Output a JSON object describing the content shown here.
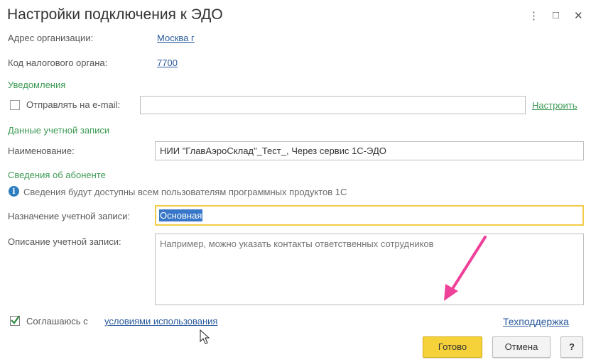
{
  "window": {
    "title": "Настройки подключения к ЭДО",
    "more_icon": "⋮",
    "maximize_icon": "□",
    "close_icon": "✕"
  },
  "org": {
    "address_label": "Адрес организации:",
    "address_value": "Москва г",
    "tax_code_label": "Код налогового органа:",
    "tax_code_value": "7700"
  },
  "notifications": {
    "section_title": "Уведомления",
    "email_checkbox_label": "Отправлять на e-mail:",
    "email_value": "",
    "configure_link": "Настроить"
  },
  "account": {
    "section_title": "Данные учетной записи",
    "name_label": "Наименование:",
    "name_value": "НИИ \"ГлавАэроСклад\"_Тест_, Через сервис 1С-ЭДО"
  },
  "subscriber": {
    "section_title": "Сведения об абоненте",
    "info_text": "Сведения будут доступны всем пользователям программных продуктов 1С",
    "purpose_label": "Назначение учетной записи:",
    "purpose_value": "Основная",
    "description_label": "Описание учетной записи:",
    "description_placeholder": "Например, можно указать контакты ответственных сотрудников"
  },
  "footer": {
    "agree_prefix": "Соглашаюсь с",
    "agree_link": "условиями использования",
    "support_link": "Техподдержка",
    "agree_checked": true
  },
  "buttons": {
    "done": "Готово",
    "cancel": "Отмена",
    "help": "?"
  },
  "colors": {
    "section": "#3d9a55",
    "link": "#2a5a9c",
    "primary_button": "#f6d23a",
    "annotation_arrow": "#f0419a"
  }
}
